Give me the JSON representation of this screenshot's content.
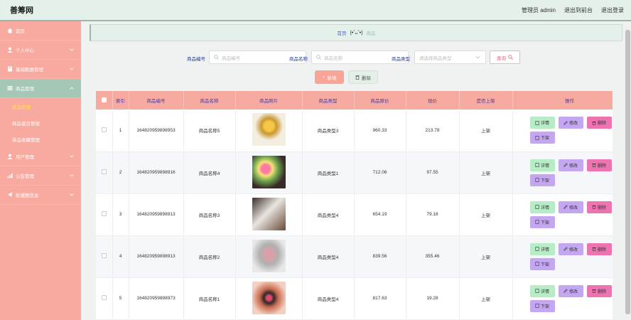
{
  "header": {
    "brand": "善筹网",
    "admin": "管理员 admin",
    "front": "退出到前台",
    "logout": "退出登录"
  },
  "sidebar": {
    "items": [
      {
        "label": "首页",
        "icon": "home-icon"
      },
      {
        "label": "个人中心",
        "icon": "user-icon"
      },
      {
        "label": "基础数据管理",
        "icon": "book-icon"
      },
      {
        "label": "商品管理",
        "icon": "list-icon"
      },
      {
        "label": "用户管理",
        "icon": "user-icon"
      },
      {
        "label": "公告管理",
        "icon": "chart-icon"
      },
      {
        "label": "轮播图信息",
        "icon": "send-icon"
      }
    ],
    "sub_items": [
      "商品管理",
      "商品留言管理",
      "商品收藏管理"
    ]
  },
  "breadcrumb": {
    "home": "首页",
    "face": "(•ˇᴗˇ•)",
    "current": "商品"
  },
  "search": {
    "code_label": "商品编号",
    "code_placeholder": "商品编号",
    "name_label": "商品名称",
    "name_placeholder": "商品名称",
    "type_label": "商品类型",
    "type_placeholder": "请选择商品类型",
    "query_label": "查询"
  },
  "actions": {
    "add_label": "新增",
    "delete_label": "删除"
  },
  "table": {
    "headers": [
      "索引",
      "商品编号",
      "商品名称",
      "商品照片",
      "商品类型",
      "商品原价",
      "现价",
      "是否上架",
      "操作"
    ],
    "rows": [
      {
        "index": "1",
        "code": "164820959898953",
        "name": "商品名称5",
        "type": "商品类型3",
        "orig": "960.33",
        "price": "213.78",
        "status": "上架"
      },
      {
        "index": "2",
        "code": "164820959898916",
        "name": "商品名称4",
        "type": "商品类型1",
        "orig": "712.06",
        "price": "97.55",
        "status": "上架"
      },
      {
        "index": "3",
        "code": "164820959898913",
        "name": "商品名称3",
        "type": "商品类型4",
        "orig": "654.19",
        "price": "79.18",
        "status": "上架"
      },
      {
        "index": "4",
        "code": "164820959898913",
        "name": "商品名称2",
        "type": "商品类型4",
        "orig": "839.56",
        "price": "355.46",
        "status": "上架"
      },
      {
        "index": "5",
        "code": "164820959898973",
        "name": "商品名称1",
        "type": "商品类型4",
        "orig": "817.63",
        "price": "19.28",
        "status": "上架"
      }
    ],
    "op_labels": {
      "detail": "详情",
      "edit": "修改",
      "delete": "删除",
      "down": "下架"
    }
  },
  "colors": {
    "sidebar": "#f9aaa0",
    "header": "#e4f1ea",
    "table_header": "#f7aa9f",
    "detail_btn": "#b6ecc6",
    "edit_btn": "#c4a7f0",
    "delete_btn": "#ee73b1"
  }
}
